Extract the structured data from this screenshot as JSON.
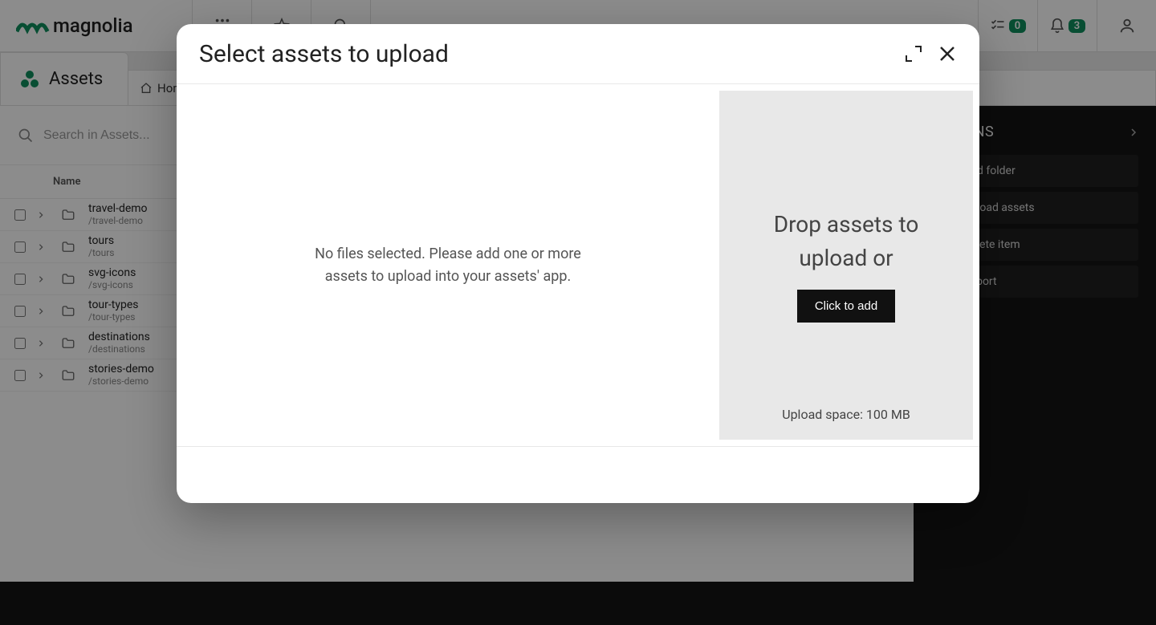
{
  "brand": "magnolia",
  "topbar": {
    "tasks_count": "0",
    "notifications_count": "3"
  },
  "app": {
    "name": "Assets",
    "breadcrumb_home": "Home"
  },
  "search": {
    "placeholder": "Search in Assets..."
  },
  "table": {
    "col_name": "Name",
    "rows": [
      {
        "name": "travel-demo",
        "path": "/travel-demo"
      },
      {
        "name": "tours",
        "path": "/tours"
      },
      {
        "name": "svg-icons",
        "path": "/svg-icons"
      },
      {
        "name": "tour-types",
        "path": "/tour-types"
      },
      {
        "name": "destinations",
        "path": "/destinations"
      },
      {
        "name": "stories-demo",
        "path": "/stories-demo"
      }
    ]
  },
  "side_actions": {
    "header": "ACTIONS",
    "items": [
      "Add folder",
      "Upload assets",
      "Delete item",
      "Import"
    ]
  },
  "modal": {
    "title": "Select assets to upload",
    "no_files_text": "No files selected. Please add one or more assets to upload into your assets' app.",
    "drop_text": "Drop assets to upload or",
    "click_to_add": "Click to add",
    "upload_space": "Upload space: 100 MB"
  }
}
